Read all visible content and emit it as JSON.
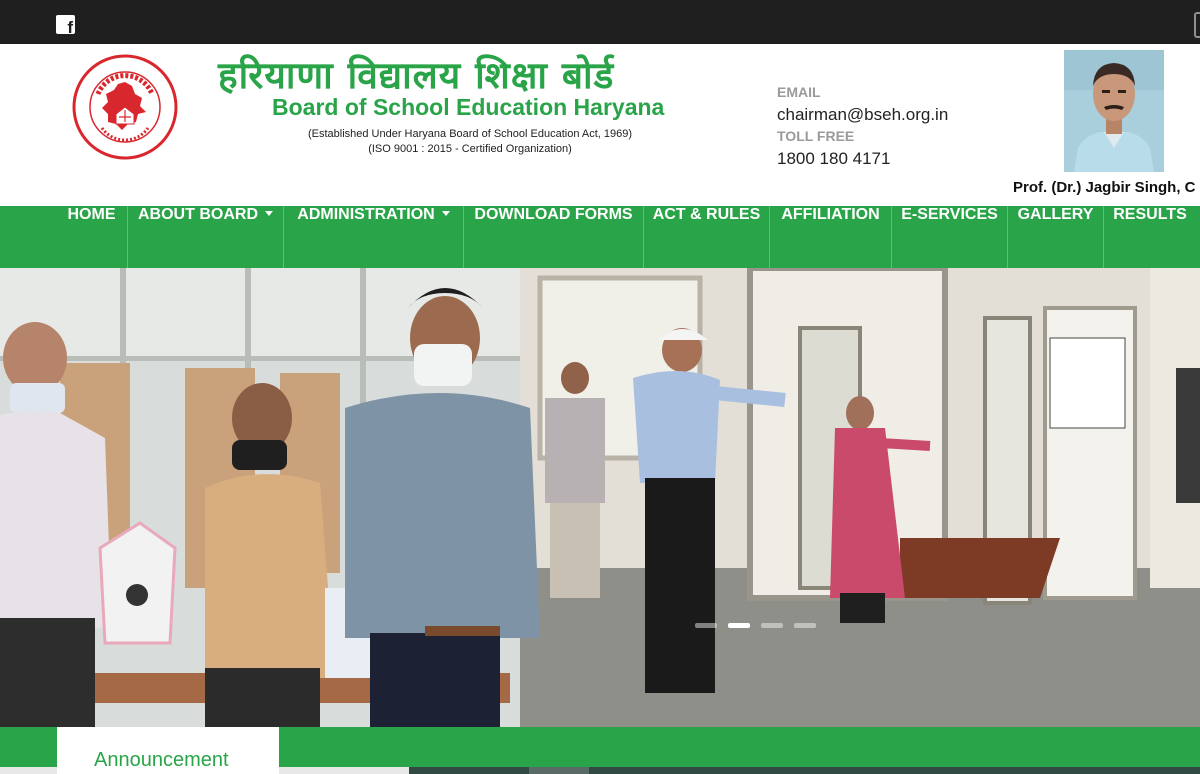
{
  "social": {
    "facebook_glyph": "f",
    "icon": "facebook-icon"
  },
  "header": {
    "title_hindi": "हरियाणा विद्यालय शिक्षा बोर्ड",
    "title_english": "Board of School Education Haryana",
    "established": "(Established Under Haryana Board of School Education Act, 1969)",
    "iso": "(ISO 9001 : 2015 - Certified Organization)",
    "email_label": "EMAIL",
    "email": "chairman@bseh.org.in",
    "tollfree_label": "TOLL FREE",
    "tollfree": "1800 180 4171",
    "chairman_caption": "Prof. (Dr.) Jagbir Singh, C"
  },
  "nav": {
    "items": [
      {
        "label": "HOME"
      },
      {
        "label": "ABOUT BOARD",
        "dropdown": true
      },
      {
        "label": "ADMINISTRATION",
        "dropdown": true
      },
      {
        "label": "DOWNLOAD FORMS"
      },
      {
        "label": "ACT & RULES"
      },
      {
        "label": "AFFILIATION"
      },
      {
        "label": "E-SERVICES"
      },
      {
        "label": "GALLERY"
      },
      {
        "label": "RESULTS"
      }
    ]
  },
  "slider": {
    "slide_count": 4,
    "active_slide": 2
  },
  "announcement": {
    "label": "Announcement"
  },
  "colors": {
    "brand_green": "#2aa448",
    "topbar": "#1f1f1f",
    "logo_red": "#d9272e"
  }
}
